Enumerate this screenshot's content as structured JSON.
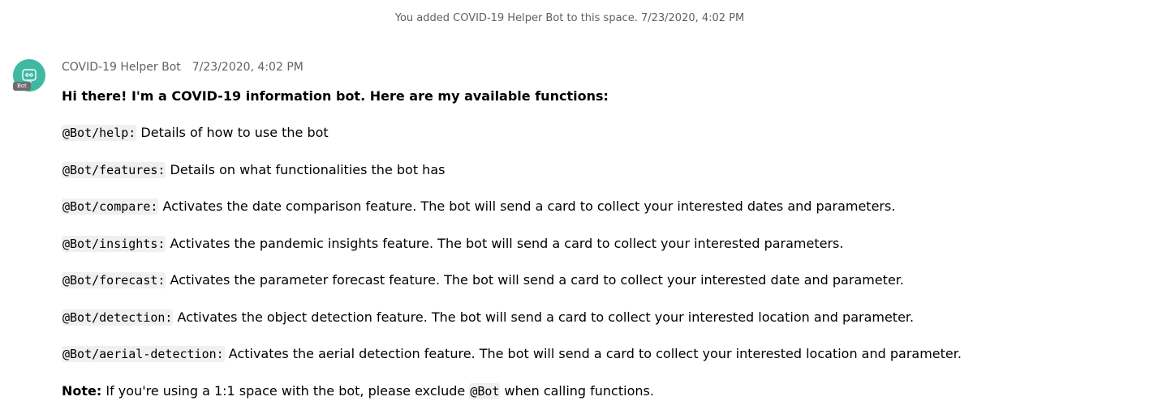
{
  "system_message": "You added COVID-19 Helper Bot to this space. 7/23/2020, 4:02 PM",
  "avatar": {
    "icon": "bot-face-icon",
    "badge": "Bot",
    "color": "#3fb8a4"
  },
  "message": {
    "sender": "COVID-19 Helper Bot",
    "timestamp": "7/23/2020, 4:02 PM",
    "greeting": "Hi there! I'm a COVID-19 information bot. Here are my available functions:",
    "commands": [
      {
        "cmd": "@Bot/help:",
        "desc": " Details of how to use the bot"
      },
      {
        "cmd": "@Bot/features:",
        "desc": " Details on what functionalities the bot has"
      },
      {
        "cmd": "@Bot/compare:",
        "desc": " Activates the date comparison feature. The bot will send a card to collect your interested dates and parameters."
      },
      {
        "cmd": "@Bot/insights:",
        "desc": " Activates the pandemic insights feature. The bot will send a card to collect your interested parameters."
      },
      {
        "cmd": "@Bot/forecast:",
        "desc": " Activates the parameter forecast feature. The bot will send a card to collect your interested date and parameter."
      },
      {
        "cmd": "@Bot/detection:",
        "desc": " Activates the object detection feature. The bot will send a card to collect your interested location and parameter."
      },
      {
        "cmd": "@Bot/aerial-detection:",
        "desc": " Activates the aerial detection feature. The bot will send a card to collect your interested location and parameter."
      }
    ],
    "note": {
      "label": "Note:",
      "text_before": " If you're using a 1:1 space with the bot, please exclude ",
      "code": "@Bot",
      "text_after": " when calling functions."
    }
  }
}
